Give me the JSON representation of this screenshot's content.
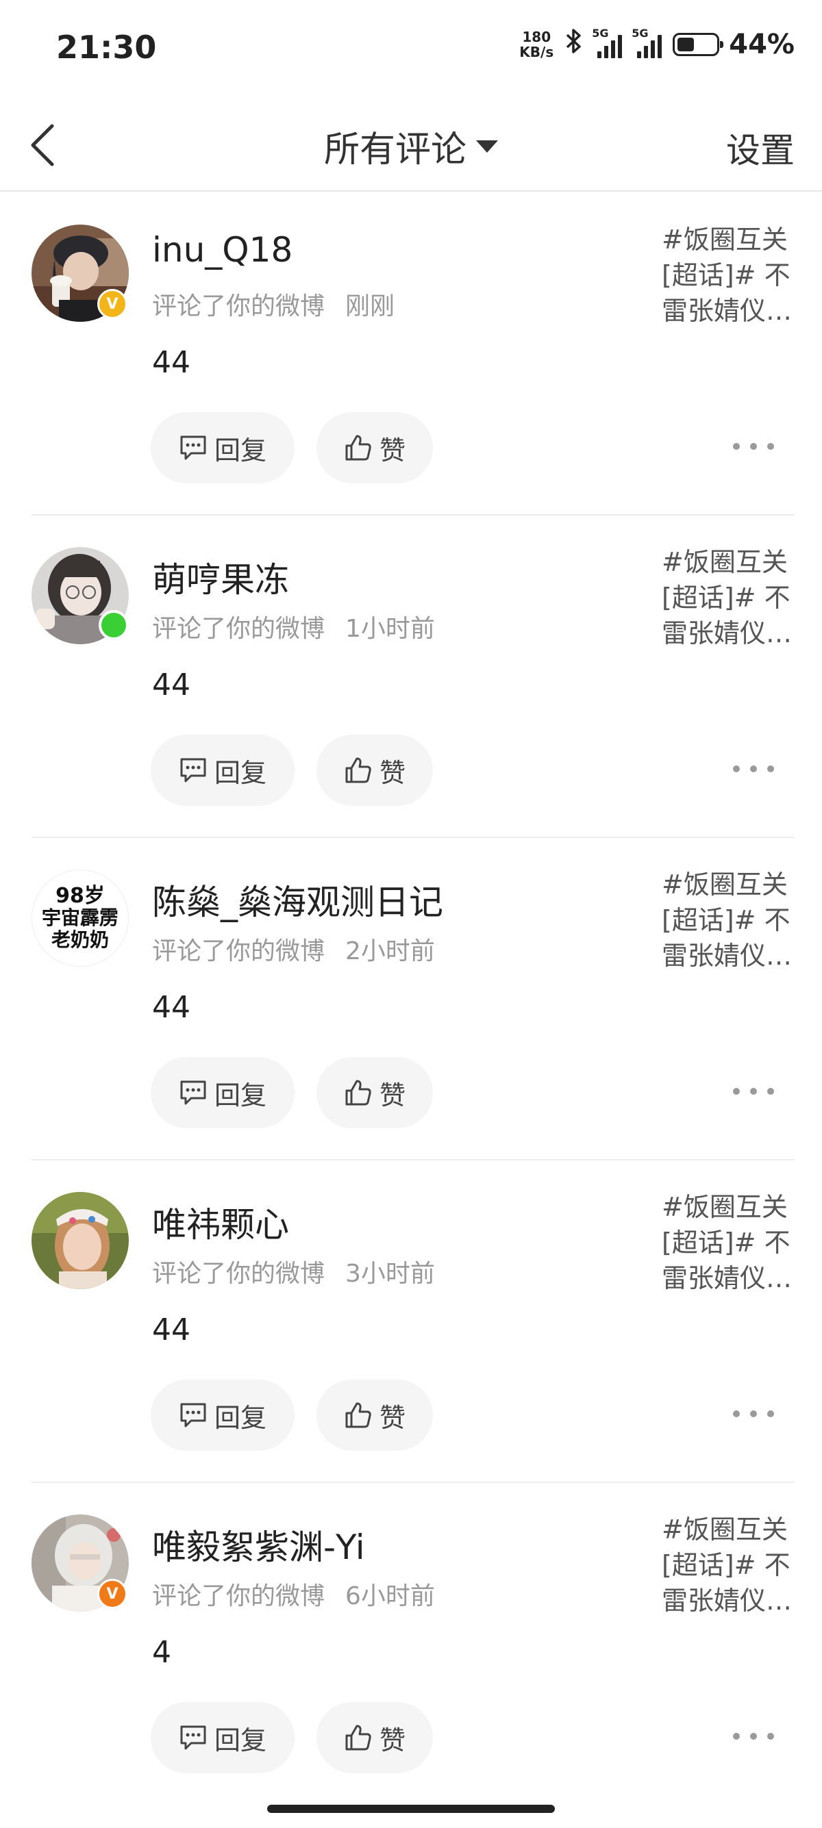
{
  "status_bar": {
    "time": "21:30",
    "net_speed_value": "180",
    "net_speed_unit": "KB/s",
    "signal1_label": "5G",
    "signal2_label": "5G",
    "battery_percent": "44%",
    "battery_level": 0.44
  },
  "header": {
    "title": "所有评论",
    "settings_label": "设置"
  },
  "comments": [
    {
      "username": "inu_Q18",
      "action": "评论了你的微博",
      "time": "刚刚",
      "content": "44",
      "topic": [
        "#饭圈互关",
        "[超话]# 不",
        "雷张婧仪…"
      ],
      "reply_label": "回复",
      "like_label": "赞",
      "badge": "V"
    },
    {
      "username": "萌哼果冻",
      "action": "评论了你的微博",
      "time": "1小时前",
      "content": "44",
      "topic": [
        "#饭圈互关",
        "[超话]# 不",
        "雷张婧仪…"
      ],
      "reply_label": "回复",
      "like_label": "赞"
    },
    {
      "username": "陈燊_燊海观测日记",
      "action": "评论了你的微博",
      "time": "2小时前",
      "content": "44",
      "topic": [
        "#饭圈互关",
        "[超话]# 不",
        "雷张婧仪…"
      ],
      "reply_label": "回复",
      "like_label": "赞",
      "avatar_text": [
        "98岁",
        "宇宙霹雳",
        "老奶奶"
      ]
    },
    {
      "username": "唯祎颗心",
      "action": "评论了你的微博",
      "time": "3小时前",
      "content": "44",
      "topic": [
        "#饭圈互关",
        "[超话]# 不",
        "雷张婧仪…"
      ],
      "reply_label": "回复",
      "like_label": "赞"
    },
    {
      "username": "唯毅絮紫渊-Yi",
      "action": "评论了你的微博",
      "time": "6小时前",
      "content": "4",
      "topic": [
        "#饭圈互关",
        "[超话]# 不",
        "雷张婧仪…"
      ],
      "reply_label": "回复",
      "like_label": "赞",
      "badge": "V"
    }
  ],
  "colors": {
    "gold_badge": "#f4b518",
    "orange_badge": "#f07a18",
    "online": "#3bcf36",
    "button_bg": "#f5f5f5"
  }
}
